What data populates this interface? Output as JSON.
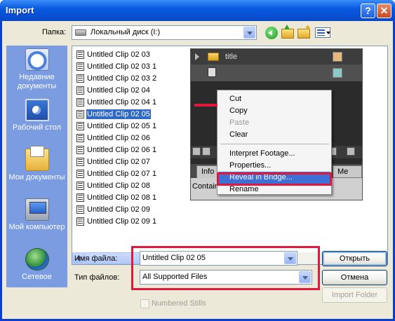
{
  "window": {
    "title": "Import",
    "help_glyph": "?",
    "close_glyph": "✕"
  },
  "toolbar": {
    "lookin_label": "Папка:",
    "lookin_value": "Локальный диск (I:)"
  },
  "places": [
    {
      "label": "Недавние документы",
      "icon": "recent-documents-icon"
    },
    {
      "label": "Рабочий стол",
      "icon": "desktop-icon"
    },
    {
      "label": "Мои документы",
      "icon": "my-documents-icon"
    },
    {
      "label": "Мой компьютер",
      "icon": "my-computer-icon"
    },
    {
      "label": "Сетевое",
      "icon": "network-icon"
    }
  ],
  "files": [
    "Untitled Clip 02 03",
    "Untitled Clip 02 03 1",
    "Untitled Clip 02 03 2",
    "Untitled Clip 02 04",
    "Untitled Clip 02 04 1",
    "Untitled Clip 02 05",
    "Untitled Clip 02 05 1",
    "Untitled Clip 02 06",
    "Untitled Clip 02 06 1",
    "Untitled Clip 02 07",
    "Untitled Clip 02 07 1",
    "Untitled Clip 02 08",
    "Untitled Clip 02 08 1",
    "Untitled Clip 02 09",
    "Untitled Clip 02 09 1"
  ],
  "selected_file": "Untitled Clip 02 05",
  "overlay": {
    "row_title": "title",
    "tab_info": "Info",
    "tab_me": "Me",
    "container_text": "Contain",
    "swatch_colors": [
      "#e6b87a",
      "#8cc9c6"
    ]
  },
  "context_menu": {
    "cut": "Cut",
    "copy": "Copy",
    "paste": "Paste",
    "clear": "Clear",
    "interpret": "Interpret Footage...",
    "properties": "Properties...",
    "reveal": "Reveal in Bridge...",
    "rename": "Rename"
  },
  "form": {
    "filename_label": "Имя файла:",
    "filename_value": "Untitled Clip 02 05",
    "filetype_label": "Тип файлов:",
    "filetype_value": "All Supported Files",
    "open_button": "Открыть",
    "cancel_button": "Отмена",
    "import_folder_button": "Import Folder",
    "numbered_stills_label": "Numbered Stills"
  },
  "colors": {
    "annotation_red": "#e11a3d",
    "selection_blue": "#316ac5",
    "places_bar": "#7b9ce0"
  }
}
